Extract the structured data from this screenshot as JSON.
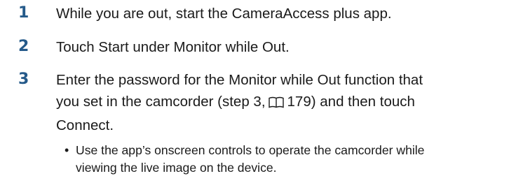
{
  "steps": [
    {
      "number": "1",
      "lines": [
        "While you are out, start the CameraAccess plus app."
      ]
    },
    {
      "number": "2",
      "lines": [
        "Touch Start under Monitor while Out."
      ]
    },
    {
      "number": "3",
      "line1": "Enter the password for the Monitor while Out function that",
      "line2_before": "you set in the camcorder (step 3,",
      "line2_icon": "book-icon",
      "line2_page": "179",
      "line2_after": ") and then touch",
      "line3": "Connect.",
      "bullet": {
        "symbol": "•",
        "lines": [
          "Use the app’s onscreen controls to operate the camcorder while",
          "viewing the live image on the device."
        ]
      }
    }
  ]
}
